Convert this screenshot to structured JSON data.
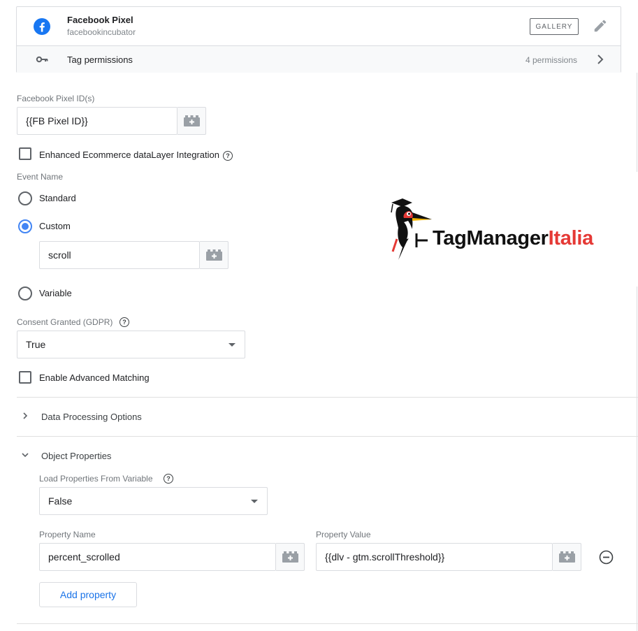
{
  "header": {
    "template_title": "Facebook Pixel",
    "template_author": "facebookincubator",
    "gallery_label": "GALLERY",
    "permissions_label": "Tag permissions",
    "permissions_count": "4 permissions"
  },
  "pixel": {
    "label": "Facebook Pixel ID(s)",
    "value": "{{FB Pixel ID}}"
  },
  "enhanced_ecommerce": {
    "label": "Enhanced Ecommerce dataLayer Integration",
    "checked": false
  },
  "event_name": {
    "label": "Event Name",
    "options": [
      "Standard",
      "Custom",
      "Variable"
    ],
    "selected": "Custom",
    "custom_value": "scroll"
  },
  "consent": {
    "label": "Consent Granted (GDPR)",
    "value": "True"
  },
  "advanced_matching": {
    "label": "Enable Advanced Matching",
    "checked": false
  },
  "sections": {
    "data_processing": "Data Processing Options",
    "object_properties": "Object Properties"
  },
  "object_properties": {
    "load_label": "Load Properties From Variable",
    "load_value": "False",
    "name_label": "Property Name",
    "value_label": "Property Value",
    "rows": [
      {
        "name": "percent_scrolled",
        "value": "{{dlv - gtm.scrollThreshold}}"
      }
    ],
    "add_label": "Add property"
  },
  "watermark": {
    "part1": "TagManager",
    "part2": "Italia",
    "color1": "#111111",
    "color2": "#e53935"
  },
  "colors": {
    "accent": "#4285f4",
    "link": "#1a73e8",
    "facebook": "#1877f2"
  }
}
